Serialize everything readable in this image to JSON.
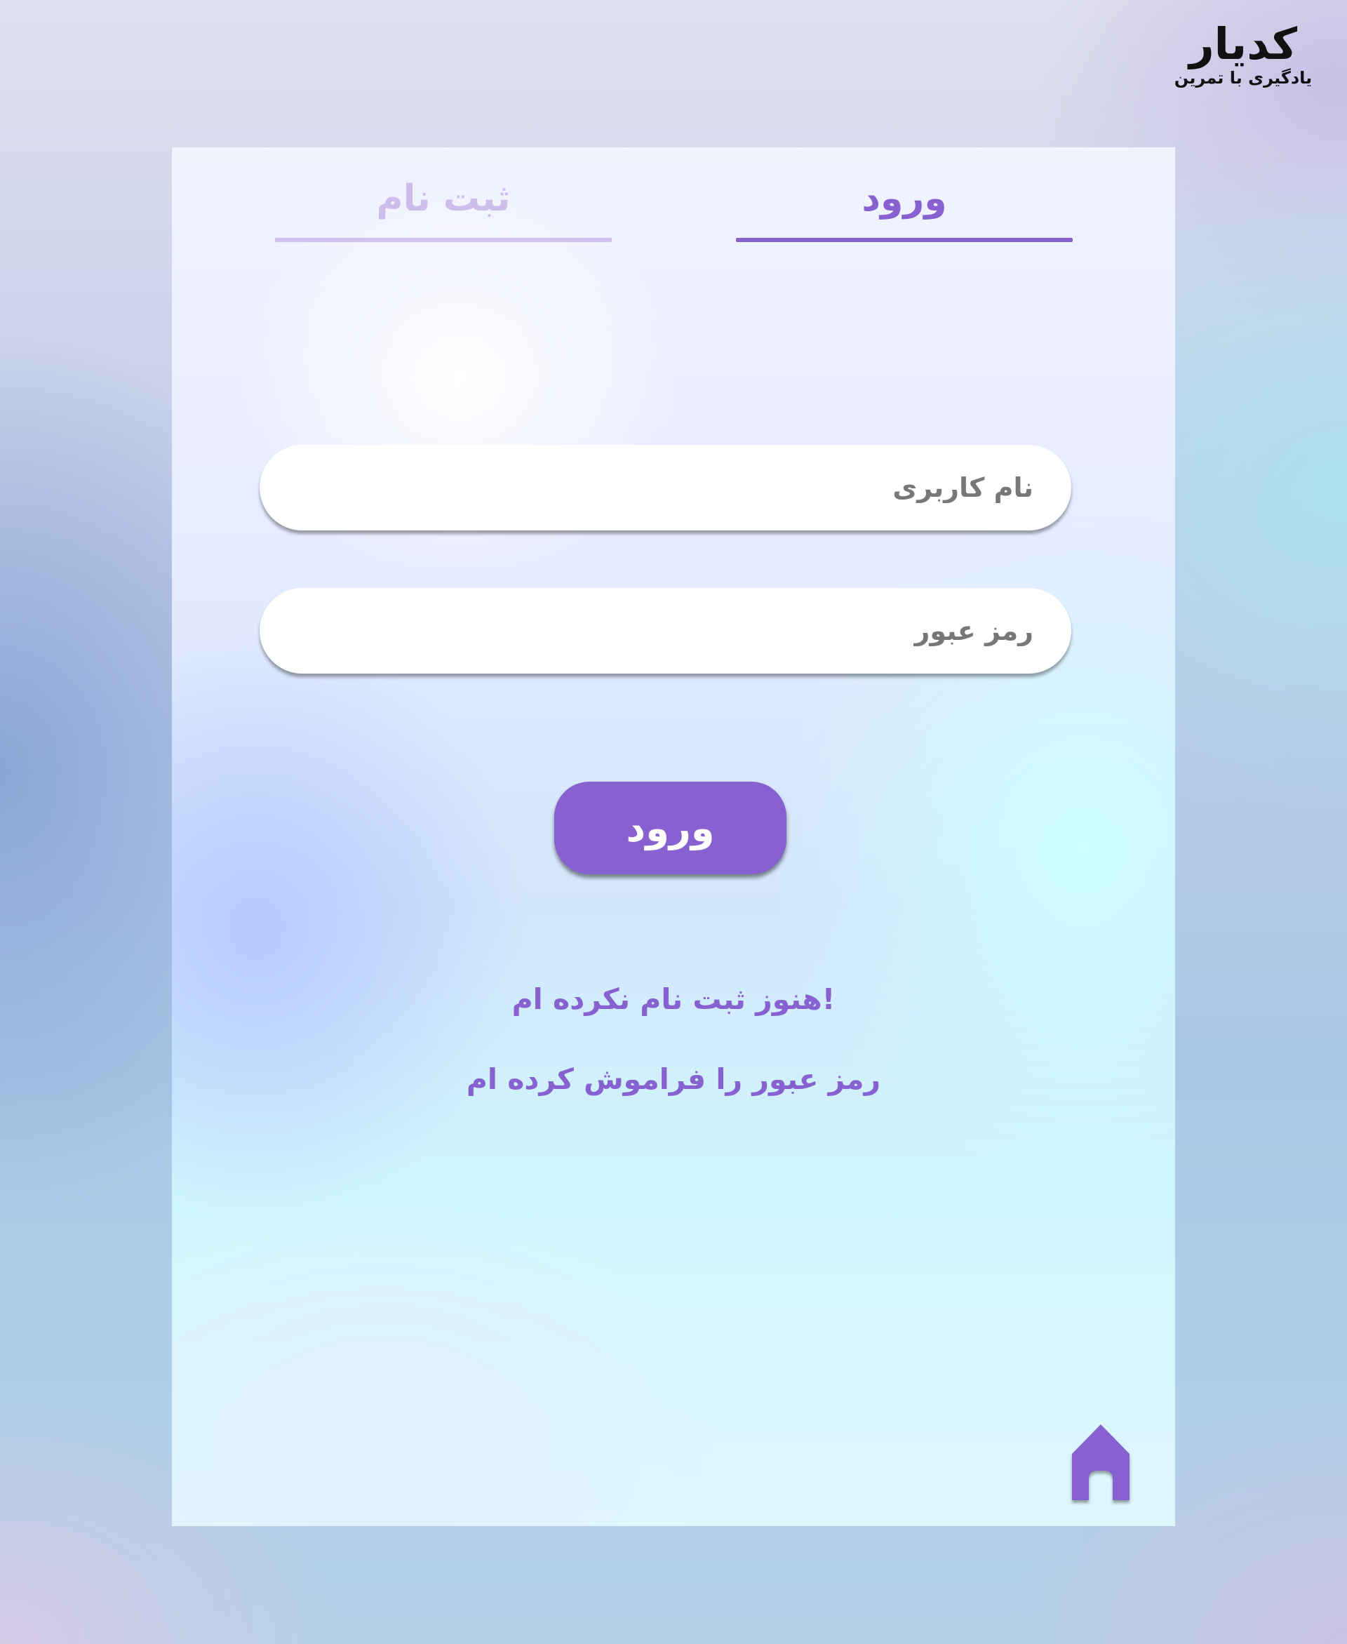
{
  "brand": {
    "name": "کدیار",
    "tagline": "یادگیری با تمرین"
  },
  "tabs": {
    "login_label": "ورود",
    "register_label": "ثبت نام",
    "active": "login"
  },
  "form": {
    "username_placeholder": "نام کاربری",
    "username_value": "",
    "password_placeholder": "رمز عبور",
    "password_value": "",
    "submit_label": "ورود"
  },
  "links": {
    "not_registered": "!هنوز ثبت نام نکرده ام",
    "forgot_password": "رمز عبور را فراموش کرده ام"
  },
  "icons": {
    "home": "home-icon"
  },
  "colors": {
    "accent": "#8761d0",
    "accent_light": "#cdbdeb",
    "placeholder": "#777777",
    "input_bg": "#ffffff"
  }
}
